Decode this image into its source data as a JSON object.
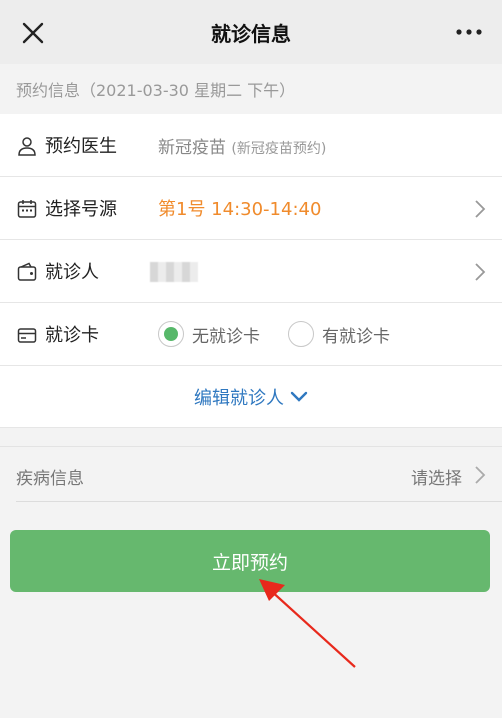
{
  "nav": {
    "title": "就诊信息"
  },
  "section": {
    "header": "预约信息（2021-03-30 星期二 下午）"
  },
  "rows": {
    "doctor": {
      "label": "预约医生",
      "value": "新冠疫苗",
      "note": "(新冠疫苗预约)"
    },
    "slot": {
      "label": "选择号源",
      "value": "第1号 14:30-14:40"
    },
    "patient": {
      "label": "就诊人"
    },
    "card": {
      "label": "就诊卡",
      "option_no": "无就诊卡",
      "option_yes": "有就诊卡"
    }
  },
  "edit": {
    "label": "编辑就诊人"
  },
  "disease": {
    "label": "疾病信息",
    "value": "请选择"
  },
  "submit": {
    "label": "立即预约"
  },
  "colors": {
    "accent": "#66b86e",
    "orange": "#f08b2c",
    "link": "#2f78c0"
  }
}
